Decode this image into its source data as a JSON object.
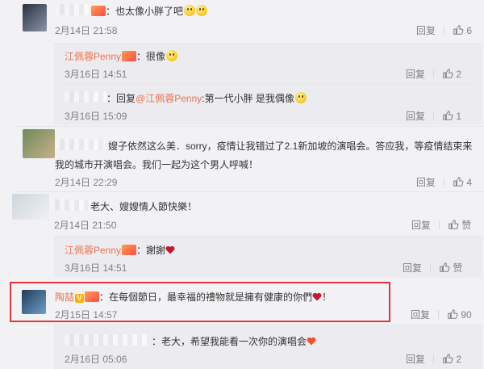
{
  "comments": [
    {
      "id": "c1",
      "text": "：也太像小胖了吧",
      "time": "2月14日 21:58",
      "reply_label": "回复",
      "likes": "6"
    },
    {
      "id": "c1r1",
      "author": "江佩蓉Penny",
      "text": "：很像",
      "time": "3月16日 14:51",
      "reply_label": "回复",
      "likes": "2"
    },
    {
      "id": "c1r2",
      "prefix": "：回复",
      "mention": "@江佩蓉Penny",
      "text": ":第一代小胖 是我偶像",
      "time": "3月16日 15:09",
      "reply_label": "回复",
      "likes": "1"
    },
    {
      "id": "c2",
      "text": "嫂子依然这么美．sorry，疫情让我错过了2.1新加坡的演唱会。答应我，等疫情结束来我的城市开演唱会。我们一起为这个男人呼喊！",
      "line1": "嫂子依然这么美．sorry，疫情让我错过了2.1新加坡的演唱会。答应我，等疫情结束来",
      "line2": "我的城市开演唱会。我们一起为这个男人呼喊！",
      "time": "2月14日 22:29",
      "reply_label": "回复",
      "likes": "4"
    },
    {
      "id": "c3",
      "text": "老大、嫂嫂情人節快樂！",
      "time": "2月14日 21:50",
      "reply_label": "回复",
      "likes": "赞"
    },
    {
      "id": "c3r1",
      "author": "江佩蓉Penny",
      "text": "：謝謝",
      "time": "3月16日 14:51",
      "reply_label": "回复",
      "likes": "赞"
    },
    {
      "id": "c4",
      "author": "陶喆",
      "text": "：在每個節日，最幸福的禮物就是擁有健康的你們",
      "suffix": "！",
      "time": "2月15日 14:57",
      "reply_label": "回复",
      "likes": "90"
    },
    {
      "id": "c4r1",
      "text": "：老大，希望我能看一次你的演唱会",
      "time": "2月16日 05:06",
      "reply_label": "回复",
      "likes": "2"
    }
  ],
  "icons": {
    "like": "thumbs-up-icon",
    "emoji": "smile-emoji-icon",
    "heart": "heart-icon",
    "vip": "vip-badge-icon",
    "fans": "fans-badge-icon"
  },
  "colors": {
    "name": "#eb7350",
    "text": "#333333",
    "meta": "#808080",
    "highlight_border": "#e2343a"
  }
}
